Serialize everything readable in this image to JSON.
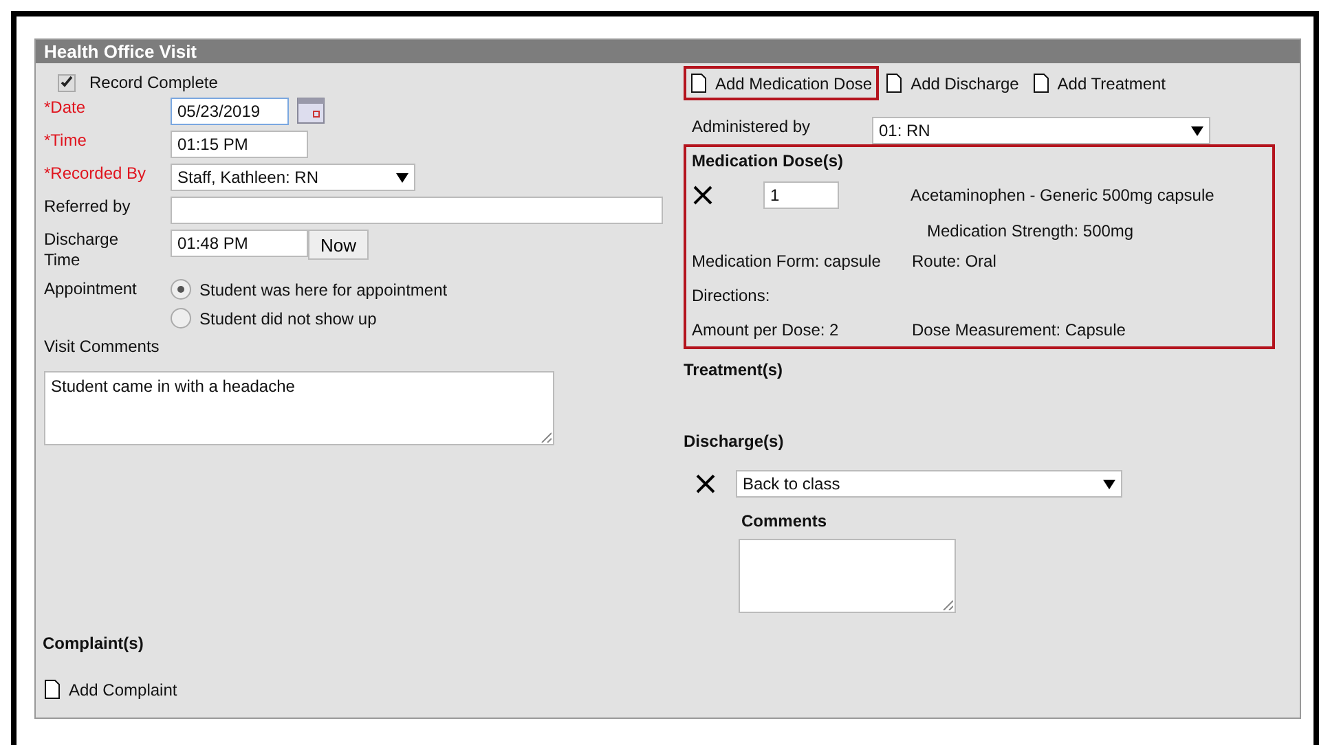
{
  "panel": {
    "title": "Health Office Visit"
  },
  "record_complete": {
    "label": "Record Complete",
    "checked": true
  },
  "fields": [
    {
      "kind": "date",
      "label": "*Date",
      "required": true,
      "value": "05/23/2019"
    },
    {
      "kind": "text",
      "label": "*Time",
      "required": true,
      "value": "01:15 PM"
    },
    {
      "kind": "select",
      "label": "*Recorded By",
      "required": true,
      "value": "Staff, Kathleen: RN"
    },
    {
      "kind": "wide",
      "label": "Referred by",
      "required": false
    },
    {
      "kind": "now",
      "label": "Discharge Time",
      "required": false,
      "value": "01:48 PM",
      "button": "Now"
    }
  ],
  "appointment": {
    "label": "Appointment",
    "options": [
      {
        "label": "Student was here for appointment",
        "selected": true
      },
      {
        "label": "Student did not show up",
        "selected": false
      }
    ]
  },
  "visit_comments": {
    "label": "Visit Comments",
    "value": "Student came in with a headache"
  },
  "complaints": {
    "heading": "Complaint(s)",
    "add": "Add Complaint"
  },
  "actions": [
    {
      "label": "Add Medication Dose",
      "highlighted": true
    },
    {
      "label": "Add Discharge",
      "highlighted": false
    },
    {
      "label": "Add Treatment",
      "highlighted": false
    }
  ],
  "administered_by": {
    "label": "Administered by",
    "value": "01: RN"
  },
  "medication": {
    "heading": "Medication Dose(s)",
    "highlighted": true,
    "quantity": "1",
    "name": "Acetaminophen - Generic 500mg capsule",
    "strength": "Medication Strength: 500mg",
    "form": "Medication Form: capsule",
    "route": "Route: Oral",
    "directions": "Directions:",
    "amount": "Amount per Dose: 2",
    "measurement": "Dose Measurement: Capsule"
  },
  "treatments": {
    "heading": "Treatment(s)"
  },
  "discharges": {
    "heading": "Discharge(s)",
    "value": "Back to class",
    "comments_label": "Comments"
  }
}
